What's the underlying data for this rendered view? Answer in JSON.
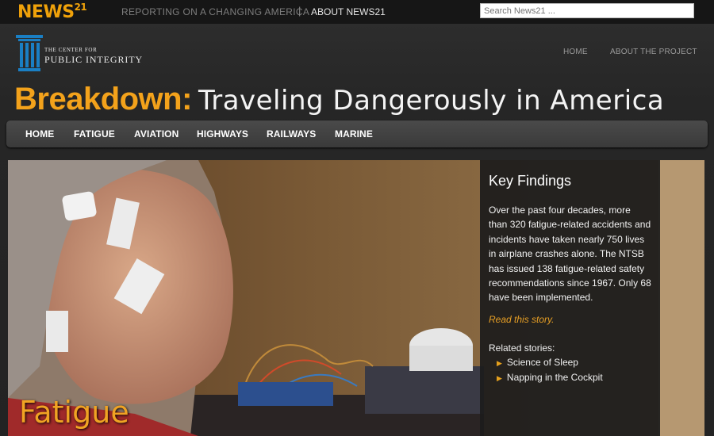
{
  "topbar": {
    "logo_text": "NEWS",
    "logo_sup": "21",
    "tagline": "REPORTING ON A CHANGING AMERICA",
    "separator": "|",
    "about_link": "ABOUT NEWS21",
    "search_placeholder": "Search News21 ..."
  },
  "header": {
    "org_small": "THE CENTER FOR",
    "org_big": "PUBLIC INTEGRITY",
    "nav": {
      "home": "HOME",
      "about": "ABOUT THE PROJECT"
    },
    "title_main": "Breakdown:",
    "title_sub": "Traveling Dangerously in America"
  },
  "mainnav": {
    "items": [
      "HOME",
      "FATIGUE",
      "AVIATION",
      "HIGHWAYS",
      "RAILWAYS",
      "MARINE"
    ]
  },
  "hero": {
    "caption": "Fatigue",
    "findings_title": "Key Findings",
    "findings_text": "Over the past four decades, more than 320 fatigue-related accidents and incidents have taken nearly 750 lives in airplane crashes alone. The NTSB has issued 138 fatigue-related safety recommendations since 1967. Only 68 have been implemented.",
    "read_link": "Read this story.",
    "related_title": "Related stories:",
    "related": [
      "Science of Sleep",
      "Napping in the Cockpit"
    ]
  },
  "colors": {
    "accent": "#f3a21b",
    "background": "#1f1f1f"
  }
}
